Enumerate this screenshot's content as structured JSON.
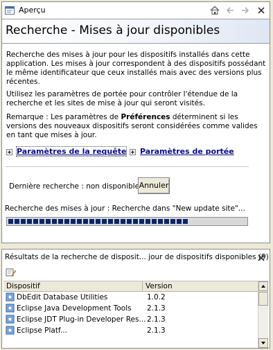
{
  "preview_view": {
    "tab_title": "Aperçu",
    "page_title": "Recherche - Mises à jour disponibles",
    "paragraph1": "Recherche des mises à jour pour les dispositifs installés dans cette application. Les mises à jour correspondent à des dispositifs possédant le même identificateur que ceux installés mais avec des versions plus récentes.",
    "paragraph2": "Utilisez les paramètres de portée pour contrôler l'étendue de la recherche et les sites de mise à jour qui seront visités.",
    "note_prefix": "Remarque : Les paramètres de ",
    "note_bold": "Préférences",
    "note_suffix": " déterminent si les versions des nouveaux dispositifs seront considérées comme valides en tant que mises à jour.",
    "query_params_link": "Paramètres de la requête",
    "scope_params_link": "Paramètres de portée",
    "last_search_label": "Dernière recherche : non disponible",
    "cancel_button": "Annuler",
    "status_text": "Recherche des mises à jour : Recherche dans \"New update site\"...",
    "progress_fraction": 0.76
  },
  "results_view": {
    "title": "Résultats de la recherche de disposit... jour de dispositifs disponibles (9)",
    "columns": [
      "Dispositif",
      "Version"
    ],
    "rows": [
      {
        "name": "DbEdit Database Utilities",
        "version": "1.0.2"
      },
      {
        "name": "Eclipse Java Development Tools",
        "version": "2.1.3"
      },
      {
        "name": "Eclipse JDT Plug-in Developer Res...",
        "version": "2.1.3"
      },
      {
        "name": "Eclipse Platf...",
        "version": "2.1.3"
      }
    ]
  },
  "colors": {
    "link": "#0a0a8c",
    "progress": "#0a246a",
    "chrome": "#ece9d8"
  }
}
